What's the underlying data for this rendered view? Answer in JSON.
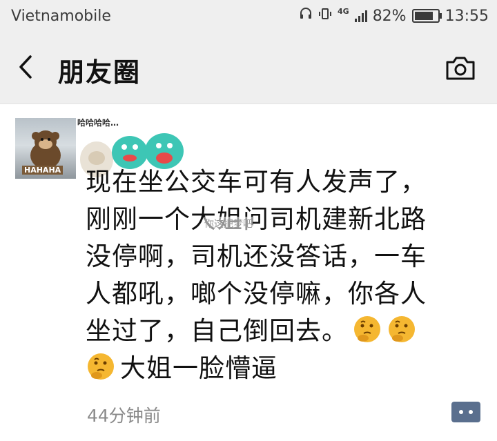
{
  "status_bar": {
    "carrier": "Vietnamobile",
    "network": "4G",
    "battery_percent": "82%",
    "battery_level": 0.82,
    "time": "13:55"
  },
  "header": {
    "title": "朋友圈",
    "back_icon": "chevron-left-icon",
    "camera_icon": "camera-icon"
  },
  "post": {
    "avatar_caption": "HAHAHA",
    "sticker_text": "哈哈哈哈…",
    "lines": [
      "现在坐公交车可有人发声了，",
      "刚刚一个大姐问司机建新北路",
      "没停啊，司机还没答话，一车",
      "人都吼，啷个没停嘛，你各人",
      "坐过了，自己倒回去。",
      "大姐一脸懵逼"
    ],
    "watermark": "你这把梦吧",
    "time": "44分钟前",
    "emoji_icon": "thinking-face-icon",
    "colors": {
      "accent": "#5a6f8e",
      "emoji": "#f5b731"
    }
  }
}
